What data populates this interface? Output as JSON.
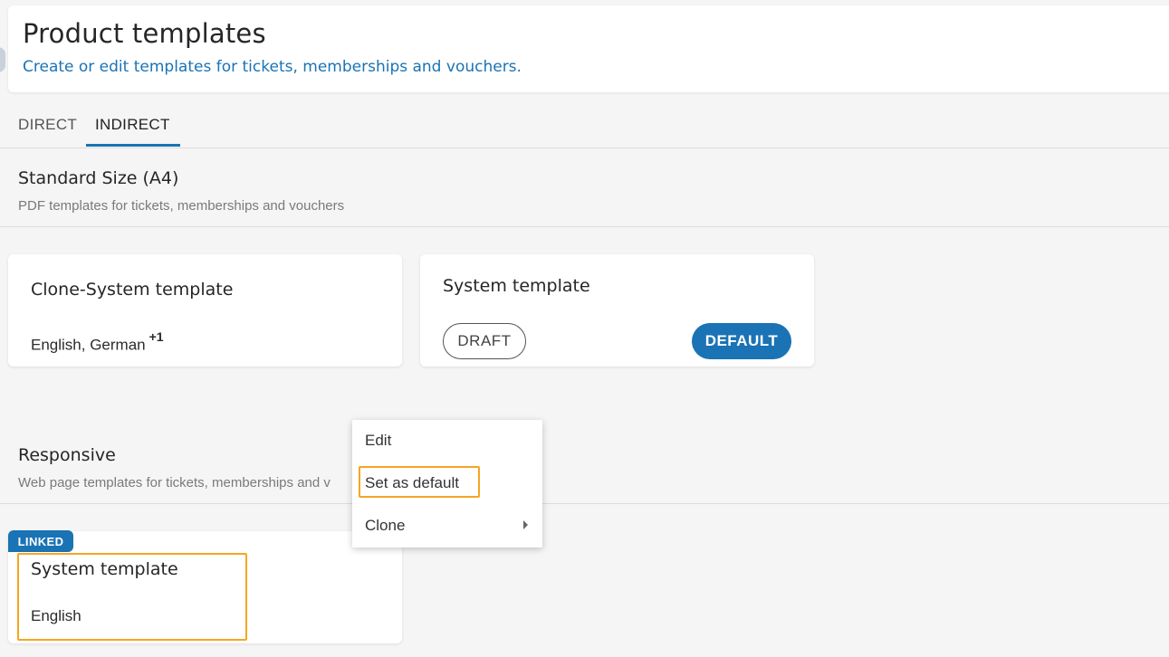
{
  "header": {
    "title": "Product templates",
    "subtitle": "Create or edit templates for tickets, memberships and vouchers."
  },
  "tabs": [
    {
      "label": "DIRECT",
      "active": false
    },
    {
      "label": "INDIRECT",
      "active": true
    }
  ],
  "sections": {
    "standard": {
      "title": "Standard Size (A4)",
      "subtitle": "PDF templates for tickets, memberships and vouchers",
      "cards": [
        {
          "title": "Clone-System template",
          "languages": "English, German",
          "extra": "+1"
        },
        {
          "title": "System template",
          "draft_label": "DRAFT",
          "default_label": "DEFAULT"
        }
      ]
    },
    "responsive": {
      "title": "Responsive",
      "subtitle": "Web page templates for tickets, memberships and v",
      "cards": [
        {
          "badge": "LINKED",
          "title": "System template",
          "languages": "English"
        }
      ]
    }
  },
  "context_menu": {
    "items": [
      {
        "label": "Edit"
      },
      {
        "label": "Set as default"
      },
      {
        "label": "Clone",
        "has_submenu": true
      }
    ]
  },
  "colors": {
    "accent": "#1a73b4",
    "highlight": "#f5a623",
    "background": "#f5f5f5"
  }
}
